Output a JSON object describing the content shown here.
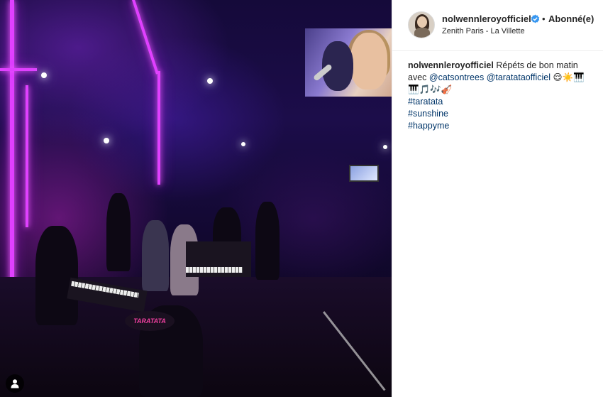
{
  "post": {
    "username": "nolwennleroyofficiel",
    "separator": "•",
    "follow_status": "Abonné(e)",
    "location": "Zenith Paris - La Villette"
  },
  "caption": {
    "username": "nolwennleroyofficiel",
    "text_line1": "Répéts de bon matin",
    "text_line2_prefix": "avec",
    "mention1": "@catsontrees",
    "mention2": "@taratataofficiel",
    "emojis_line1": "😌☀️🎹",
    "emojis_line2": "🎹🎵🎶🎻",
    "hashtags": [
      "#taratata",
      "#sunshine",
      "#happyme"
    ]
  },
  "photo": {
    "stage_sign": "TARATATA"
  },
  "icons": {
    "verified": "verified-badge-icon",
    "video": "user-tag-icon"
  },
  "colors": {
    "link": "#003569",
    "verified": "#3897f0",
    "neon": "#e040ff"
  }
}
